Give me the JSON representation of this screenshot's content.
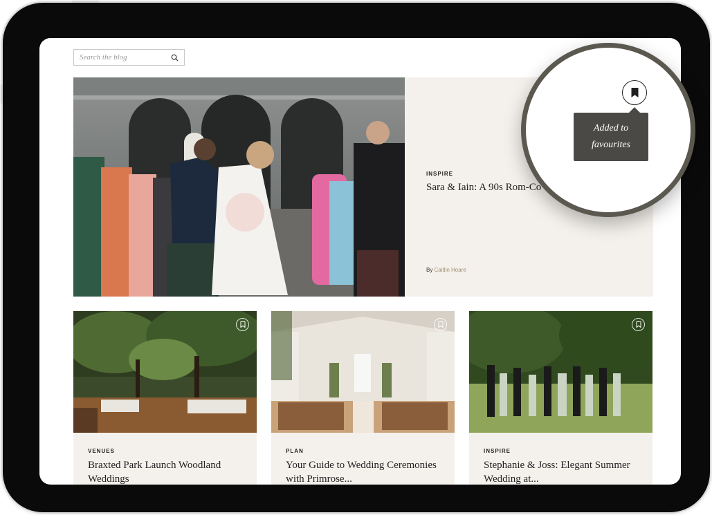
{
  "search": {
    "placeholder": "Search the blog"
  },
  "featured": {
    "category": "INSPIRE",
    "title": "Sara & Iain: A 90s Rom-Co",
    "by_label": "By",
    "author": "Caitlin Hoare"
  },
  "favourite": {
    "tooltip_line1": "Added to",
    "tooltip_line2": "favourites"
  },
  "cards": [
    {
      "category": "VENUES",
      "title": "Braxted Park Launch Woodland Weddings"
    },
    {
      "category": "PLAN",
      "title": "Your Guide to Wedding Ceremonies with Primrose..."
    },
    {
      "category": "INSPIRE",
      "title": "Stephanie & Joss: Elegant Summer Wedding at..."
    }
  ],
  "icons": {
    "search": "magnifier-icon",
    "bookmark": "bookmark-icon"
  },
  "colors": {
    "device_bezel": "#0a0a0a",
    "panel_bg": "#f4f1ec",
    "tooltip_bg": "#4a4946",
    "author_link": "#a08f73",
    "magnifier_ring": "#5a584f"
  }
}
